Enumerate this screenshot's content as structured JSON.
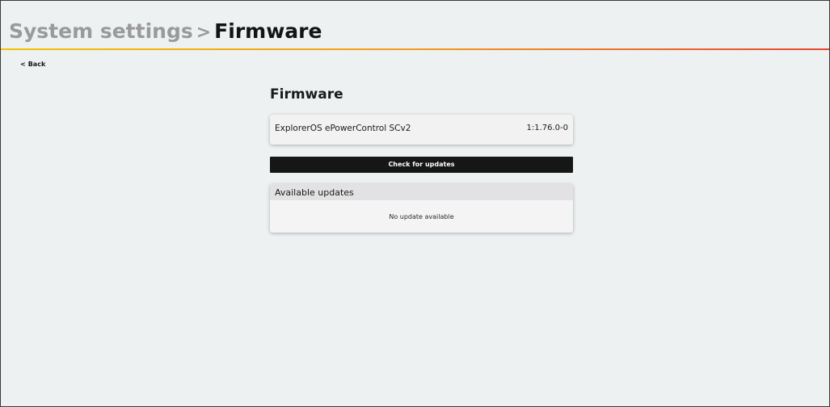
{
  "header": {
    "breadcrumb_parent": "System settings",
    "breadcrumb_separator": ">",
    "breadcrumb_current": "Firmware"
  },
  "nav": {
    "back_icon": "<",
    "back_label": "Back"
  },
  "main": {
    "title": "Firmware",
    "firmware": {
      "name": "ExplorerOS ePowerControl SCv2",
      "version": "1:1.76.0-0"
    },
    "check_updates_label": "Check for updates",
    "available_updates": {
      "title": "Available updates",
      "status": "No update available"
    }
  },
  "colors": {
    "background": "#edf1f2",
    "button": "#161616",
    "accent_gradient": [
      "#f2c200",
      "#f39a1c",
      "#e8452c"
    ]
  },
  "icons": {
    "back": "chevron-left-icon"
  }
}
